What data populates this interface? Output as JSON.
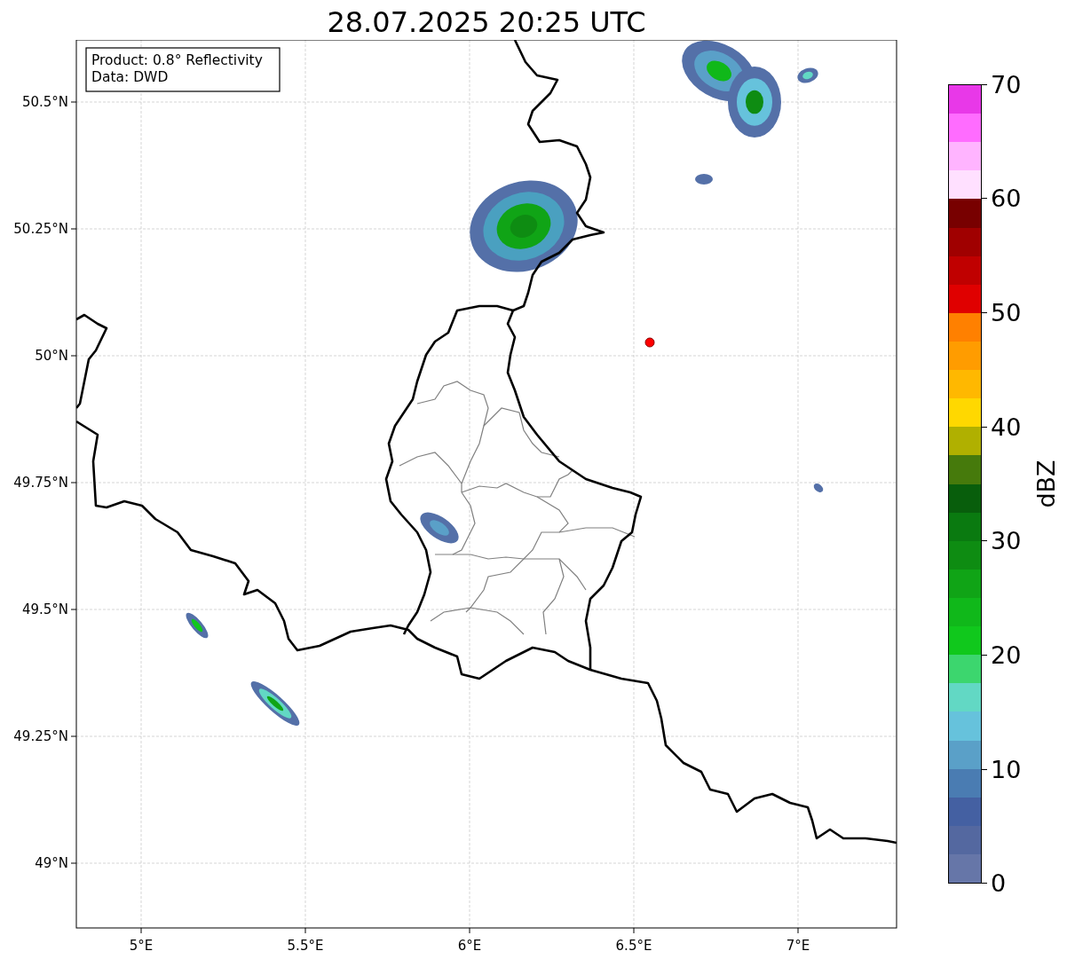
{
  "title": "28.07.2025 20:25 UTC",
  "info_box": [
    "Product: 0.8° Reflectivity",
    "Data: DWD"
  ],
  "map": {
    "lat_ticks": [
      "50.5°N",
      "50.25°N",
      "50°N",
      "49.75°N",
      "49.5°N",
      "49.25°N",
      "49°N"
    ],
    "lon_ticks": [
      "5°E",
      "5.5°E",
      "6°E",
      "6.5°E",
      "7°E"
    ]
  },
  "colorbar": {
    "ticks": [
      "70",
      "60",
      "50",
      "40",
      "30",
      "20",
      "10",
      "0"
    ],
    "label": "dBZ",
    "levels": [
      {
        "color": "#e838e8"
      },
      {
        "color": "#ff6cff"
      },
      {
        "color": "#ffb4ff"
      },
      {
        "color": "#ffe0ff"
      },
      {
        "color": "#780000"
      },
      {
        "color": "#a00000"
      },
      {
        "color": "#c00000"
      },
      {
        "color": "#e00000"
      },
      {
        "color": "#ff8000"
      },
      {
        "color": "#ff9c00"
      },
      {
        "color": "#ffb800"
      },
      {
        "color": "#ffd800"
      },
      {
        "color": "#b0b000"
      },
      {
        "color": "#467a0c"
      },
      {
        "color": "#085e0c"
      },
      {
        "color": "#0a7a10"
      },
      {
        "color": "#0e8c12"
      },
      {
        "color": "#10a416"
      },
      {
        "color": "#10b81a"
      },
      {
        "color": "#10c81c"
      },
      {
        "color": "#3cd66e"
      },
      {
        "color": "#62d8c4"
      },
      {
        "color": "#66c2dc"
      },
      {
        "color": "#5aa0c8"
      },
      {
        "color": "#4a7cb2"
      },
      {
        "color": "#4460a2"
      },
      {
        "color": "#5468a0"
      },
      {
        "color": "#6676a8"
      }
    ]
  }
}
